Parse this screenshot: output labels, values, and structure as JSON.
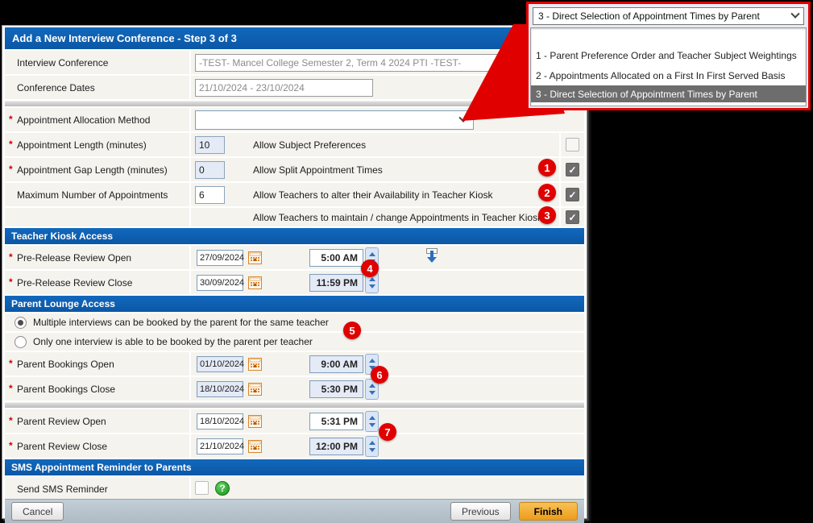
{
  "window": {
    "title": "Add a New Interview Conference - Step 3 of 3"
  },
  "allocation_overlay": {
    "selected": "3 - Direct Selection of Appointment Times by Parent",
    "options": [
      "",
      "1 - Parent Preference Order and Teacher Subject Weightings",
      "2 - Appointments Allocated on a First In First Served Basis",
      "3 - Direct Selection of Appointment Times by Parent"
    ]
  },
  "form": {
    "interview_conference": {
      "label": "Interview Conference",
      "value": "-TEST- Mancel College Semester 2, Term 4 2024 PTI -TEST-"
    },
    "conference_dates": {
      "label": "Conference Dates",
      "value": "21/10/2024 - 23/10/2024"
    },
    "allocation_method": {
      "label": "Appointment Allocation Method",
      "value": ""
    },
    "appointment_length": {
      "label": "Appointment Length (minutes)",
      "value": "10"
    },
    "appointment_gap": {
      "label": "Appointment Gap Length (minutes)",
      "value": "0"
    },
    "max_appointments": {
      "label": "Maximum Number of Appointments",
      "value": "6"
    },
    "allow_subject_preferences": {
      "label": "Allow Subject Preferences",
      "checked": false
    },
    "allow_split_times": {
      "label": "Allow Split Appointment Times",
      "checked": true,
      "badge": "1"
    },
    "allow_alter_availability": {
      "label": "Allow Teachers to alter their Availability in Teacher Kiosk",
      "checked": true,
      "badge": "2"
    },
    "allow_maintain_appointments": {
      "label": "Allow Teachers to maintain / change Appointments in Teacher Kiosk",
      "checked": true,
      "badge": "3"
    }
  },
  "teacher_kiosk": {
    "title": "Teacher Kiosk Access",
    "pre_release_open": {
      "label": "Pre-Release Review Open",
      "date": "27/09/2024",
      "time": "5:00 AM"
    },
    "pre_release_close": {
      "label": "Pre-Release Review Close",
      "date": "30/09/2024",
      "time": "11:59 PM"
    },
    "badge": "4"
  },
  "parent_lounge": {
    "title": "Parent Lounge Access",
    "radio_multiple": {
      "label": "Multiple interviews can be booked by the parent for the same teacher",
      "selected": true
    },
    "radio_single": {
      "label": "Only one interview is able to be booked by the parent per teacher",
      "selected": false
    },
    "radio_badge": "5",
    "bookings_open": {
      "label": "Parent Bookings Open",
      "date": "01/10/2024",
      "time": "9:00 AM"
    },
    "bookings_close": {
      "label": "Parent Bookings Close",
      "date": "18/10/2024",
      "time": "5:30 PM"
    },
    "bookings_badge": "6",
    "review_open": {
      "label": "Parent Review Open",
      "date": "18/10/2024",
      "time": "5:31 PM"
    },
    "review_close": {
      "label": "Parent Review Close",
      "date": "21/10/2024",
      "time": "12:00 PM"
    },
    "review_badge": "7"
  },
  "sms": {
    "title": "SMS Appointment Reminder to Parents",
    "send_label": "Send SMS Reminder",
    "checked": false
  },
  "footer": {
    "cancel": "Cancel",
    "previous": "Previous",
    "finish": "Finish"
  },
  "colors": {
    "header_blue": "#0e60b4",
    "badge_red": "#e00000",
    "finish_orange": "#f2a32d",
    "highlight_grey": "#6d6d6d",
    "overlay_border_red": "#e10000"
  }
}
